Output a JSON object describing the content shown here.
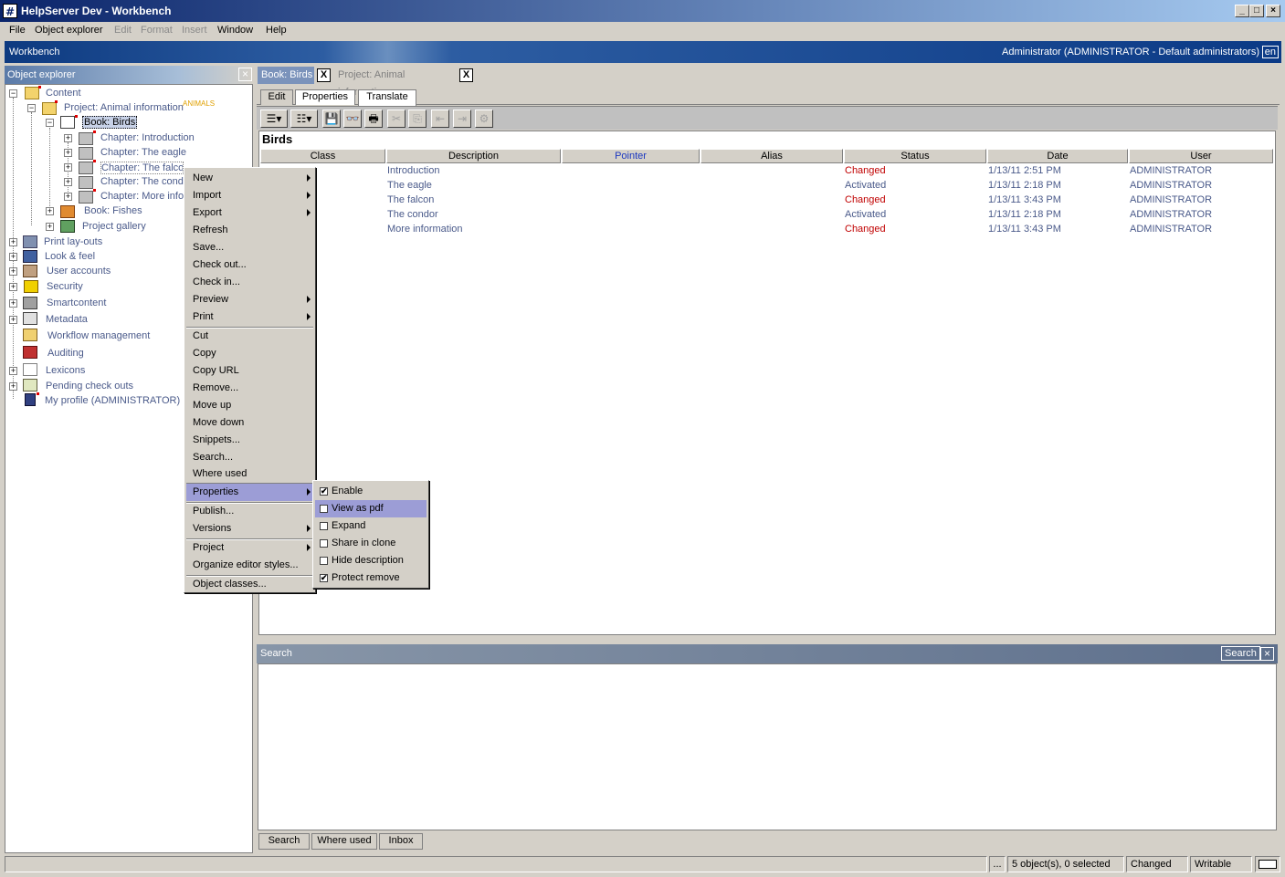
{
  "window": {
    "title": "HelpServer Dev - Workbench",
    "minimize_label": "_",
    "maximize_label": "□",
    "close_label": "×"
  },
  "menubar": {
    "items": [
      "File",
      "Object explorer",
      "Edit",
      "Format",
      "Insert",
      "Window",
      "Help"
    ]
  },
  "workbench_bar": {
    "title": "Workbench",
    "user": "Administrator (ADMINISTRATOR - Default administrators)",
    "language": "en"
  },
  "object_explorer": {
    "title": "Object explorer",
    "close_label": "×",
    "tree": {
      "content": "Content",
      "project": "Project: Animal information",
      "project_badge": "ANIMALS",
      "book_birds": "Book: Birds",
      "chapters": [
        "Chapter: Introduction",
        "Chapter: The eagle",
        "Chapter: The falcon",
        "Chapter: The condor",
        "Chapter: More information"
      ],
      "book_fishes": "Book: Fishes",
      "project_gallery": "Project gallery",
      "print_layouts": "Print lay-outs",
      "look_feel": "Look & feel",
      "user_accounts": "User accounts",
      "security": "Security",
      "smartcontent": "Smartcontent",
      "metadata": "Metadata",
      "workflow": "Workflow management",
      "auditing": "Auditing",
      "lexicons": "Lexicons",
      "pending": "Pending check outs",
      "profile": "My profile (ADMINISTRATOR)"
    }
  },
  "doc_tabs": {
    "active": "Book: Birds",
    "inactive": "Project: Animal information",
    "close_label": "X"
  },
  "view_tabs": [
    "Edit",
    "Properties",
    "Translate"
  ],
  "table": {
    "title": "Birds",
    "columns": [
      "Class",
      "Description",
      "Pointer",
      "Alias",
      "Status",
      "Date",
      "User"
    ],
    "rows": [
      {
        "description": "Introduction",
        "status": "Changed",
        "date": "1/13/11 2:51 PM",
        "user": "ADMINISTRATOR"
      },
      {
        "description": "The eagle",
        "status": "Activated",
        "date": "1/13/11 2:18 PM",
        "user": "ADMINISTRATOR"
      },
      {
        "description": "The falcon",
        "status": "Changed",
        "date": "1/13/11 3:43 PM",
        "user": "ADMINISTRATOR"
      },
      {
        "description": "The condor",
        "status": "Activated",
        "date": "1/13/11 2:18 PM",
        "user": "ADMINISTRATOR"
      },
      {
        "description": "More information",
        "status": "Changed",
        "date": "1/13/11 3:43 PM",
        "user": "ADMINISTRATOR"
      }
    ]
  },
  "context_menu": {
    "items": [
      "New",
      "Import",
      "Export",
      "Refresh",
      "Save...",
      "Check out...",
      "Check in...",
      "Preview",
      "Print",
      "Cut",
      "Copy",
      "Copy URL",
      "Remove...",
      "Move up",
      "Move down",
      "Snippets...",
      "Search...",
      "Where used",
      "Properties",
      "Publish...",
      "Versions",
      "Project",
      "Organize editor styles...",
      "Object classes..."
    ]
  },
  "properties_submenu": {
    "items": [
      {
        "label": "Enable",
        "checked": true
      },
      {
        "label": "View as pdf",
        "checked": false
      },
      {
        "label": "Expand",
        "checked": false
      },
      {
        "label": "Share in clone",
        "checked": false
      },
      {
        "label": "Hide description",
        "checked": false
      },
      {
        "label": "Protect remove",
        "checked": true
      }
    ],
    "check_mark": "✔"
  },
  "search_panel": {
    "title": "Search",
    "button": "Search",
    "close_label": "×",
    "tabs": [
      "Search",
      "Where used",
      "Inbox"
    ]
  },
  "statusbar": {
    "more": "...",
    "selection": "5 object(s), 0 selected",
    "state": "Changed",
    "mode": "Writable"
  }
}
